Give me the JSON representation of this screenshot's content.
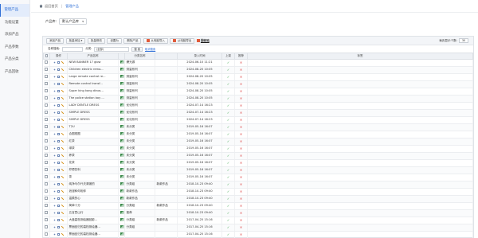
{
  "sidebar": {
    "items": [
      {
        "label": "管理产品",
        "active": true
      },
      {
        "label": "功能设置",
        "active": false
      },
      {
        "label": "添加产品",
        "active": false
      },
      {
        "label": "产品参数",
        "active": false
      },
      {
        "label": "产品分类",
        "active": false
      },
      {
        "label": "产品回收",
        "active": false
      }
    ]
  },
  "breadcrumb": {
    "home": "返回首页",
    "current": "管理产品"
  },
  "filter": {
    "label": "产品库:",
    "value": "默认产品库"
  },
  "toolbar": {
    "buttons": [
      "添加产品",
      "批量添加",
      "批量修改",
      "设置为",
      "删除产品"
    ],
    "csv_import": "从电脑导入",
    "csv_export": "从电脑导出",
    "recycle_link": "回收站",
    "per_page_label": "每页显示个数:",
    "per_page_value": "30"
  },
  "search": {
    "label_name": "名称搜索:",
    "name_value": "",
    "label_cat": "分类:",
    "cat_value": "(全部)",
    "search_btn": "搜 索",
    "clear_link": "取消搜索"
  },
  "table": {
    "headers": [
      "",
      "操作",
      "产品名称",
      "",
      "分类名称",
      "",
      "录入时间",
      "上架",
      "推荐",
      "标签"
    ],
    "rows": [
      {
        "name": "NEW BANNER 17 glow",
        "cat": "爆光源",
        "cat2": "",
        "time": "2024-06-10 11:21",
        "on": true,
        "rec": false
      },
      {
        "name": "Children electric remo...",
        "cat": "测量系列",
        "cat2": "",
        "time": "2024-08-20 10:05",
        "on": true,
        "rec": false
      },
      {
        "name": "Large remote control re...",
        "cat": "测量系列",
        "cat2": "",
        "time": "2024-08-20 10:05",
        "on": true,
        "rec": false
      },
      {
        "name": "Remote control transf...",
        "cat": "测量系列",
        "cat2": "",
        "time": "2024-08-20 10:05",
        "on": true,
        "rec": false
      },
      {
        "name": "Super king kong dinos...",
        "cat": "测量系列",
        "cat2": "",
        "time": "2024-08-20 10:05",
        "on": true,
        "rec": false
      },
      {
        "name": "The police station boy ...",
        "cat": "测量系列",
        "cat2": "",
        "time": "2024-08-20 10:05",
        "on": true,
        "rec": false
      },
      {
        "name": "LADY DENTLE DRESS",
        "cat": "优化系列",
        "cat2": "",
        "time": "2024-07-14 16:23",
        "on": true,
        "rec": false
      },
      {
        "name": "SIMPLE DRESS",
        "cat": "优化系列",
        "cat2": "",
        "time": "2024-07-14 16:23",
        "on": true,
        "rec": false
      },
      {
        "name": "SIMPLE DRESS",
        "cat": "优化系列",
        "cat2": "",
        "time": "2024-07-14 16:23",
        "on": true,
        "rec": false
      },
      {
        "name": "T2U",
        "cat": "未分类",
        "cat2": "",
        "time": "2019-05-16 16:07",
        "on": true,
        "rec": false
      },
      {
        "name": "合图视图",
        "cat": "未分类",
        "cat2": "",
        "time": "2019-05-16 16:07",
        "on": true,
        "rec": false
      },
      {
        "name": "红茶",
        "cat": "未分类",
        "cat2": "",
        "time": "2019-05-16 16:07",
        "on": true,
        "rec": false
      },
      {
        "name": "绿茶",
        "cat": "未分类",
        "cat2": "",
        "time": "2019-05-16 16:07",
        "on": true,
        "rec": false
      },
      {
        "name": "养茶",
        "cat": "未分类",
        "cat2": "",
        "time": "2019-05-16 16:07",
        "on": true,
        "rec": false
      },
      {
        "name": "花茶",
        "cat": "未分类",
        "cat2": "",
        "time": "2019-05-16 16:07",
        "on": true,
        "rec": false
      },
      {
        "name": "柠檬饮料",
        "cat": "未分类",
        "cat2": "",
        "time": "2019-05-16 16:07",
        "on": true,
        "rec": false
      },
      {
        "name": "茶",
        "cat": "未分类",
        "cat2": "",
        "time": "2019-05-16 16:07",
        "on": true,
        "rec": false
      },
      {
        "name": "纯净马尔代夫清澈的",
        "cat": "分类组",
        "cat2": "新款作品",
        "time": "2018-10-23 09:40",
        "on": true,
        "rec": false
      },
      {
        "name": "浪漫和你相伴",
        "cat": "新款作品",
        "cat2": "",
        "time": "2018-10-23 09:40",
        "on": true,
        "rec": false
      },
      {
        "name": "温柔的心",
        "cat": "新款作品",
        "cat2": "",
        "time": "2018-10-23 09:40",
        "on": true,
        "rec": false
      },
      {
        "name": "简单十分",
        "cat": "分类组",
        "cat2": "新款作品",
        "time": "2018-10-23 09:40",
        "on": true,
        "rec": false
      },
      {
        "name": "五言意山行",
        "cat": "推荐",
        "cat2": "",
        "time": "2018-10-23 09:40",
        "on": true,
        "rec": false
      },
      {
        "name": "大盘高档测绘器回影...",
        "cat": "分类组",
        "cat2": "新款作品",
        "time": "2017-04-25 15:16",
        "on": true,
        "rec": false
      },
      {
        "name": "票面回归的高档测绘器...",
        "cat": "分类组",
        "cat2": "",
        "time": "2017-04-25 15:16",
        "on": true,
        "rec": false
      },
      {
        "name": "票面回归的高档测绘器...",
        "cat": "",
        "cat2": "",
        "time": "2017-04-25 15:16",
        "on": true,
        "rec": false
      }
    ]
  }
}
